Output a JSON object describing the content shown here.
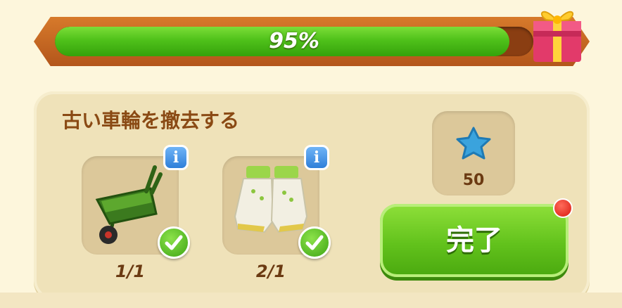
{
  "progress": {
    "value": 0.95,
    "label": "95%"
  },
  "task": {
    "title": "古い車輪を撤去する",
    "requirements": [
      {
        "item_icon": "wheelbarrow-icon",
        "count": "1/1",
        "completed": true
      },
      {
        "item_icon": "gardening-gloves-icon",
        "count": "2/1",
        "completed": true
      }
    ]
  },
  "reward": {
    "icon": "blue-star-icon",
    "amount": "50"
  },
  "complete_button": {
    "label": "完了"
  },
  "colors": {
    "accent_green": "#4fc11a",
    "title_brown": "#8a4a14",
    "frame_orange": "#c8672a"
  }
}
